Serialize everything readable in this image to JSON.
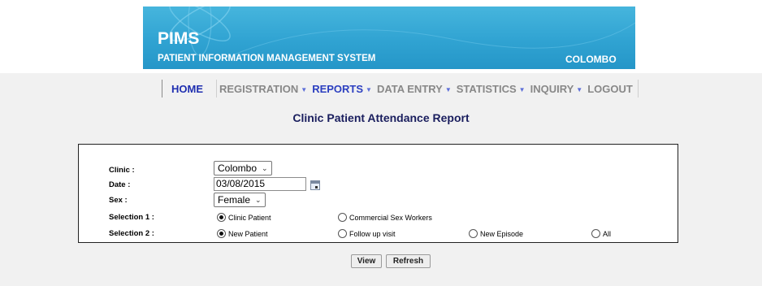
{
  "header": {
    "title": "PIMS",
    "subtitle": "PATIENT INFORMATION MANAGEMENT SYSTEM",
    "location": "COLOMBO"
  },
  "nav": {
    "items": [
      {
        "label": "HOME",
        "dropdown": false
      },
      {
        "label": "REGISTRATION",
        "dropdown": true
      },
      {
        "label": "REPORTS",
        "dropdown": true
      },
      {
        "label": "DATA ENTRY",
        "dropdown": true
      },
      {
        "label": "STATISTICS",
        "dropdown": true
      },
      {
        "label": "INQUIRY",
        "dropdown": true
      },
      {
        "label": "LOGOUT",
        "dropdown": false
      }
    ]
  },
  "report": {
    "title": "Clinic Patient Attendance Report"
  },
  "form": {
    "clinic": {
      "label": "Clinic :",
      "value": "Colombo"
    },
    "date": {
      "label": "Date :",
      "value": "03/08/2015"
    },
    "sex": {
      "label": "Sex :",
      "value": "Female"
    },
    "selection1": {
      "label": "Selection 1 :",
      "options": [
        {
          "label": "Clinic Patient",
          "checked": true
        },
        {
          "label": "Commercial Sex Workers",
          "checked": false
        }
      ]
    },
    "selection2": {
      "label": "Selection 2 :",
      "options": [
        {
          "label": "New Patient",
          "checked": true
        },
        {
          "label": "Follow up visit",
          "checked": false
        },
        {
          "label": "New Episode",
          "checked": false
        },
        {
          "label": "All",
          "checked": false
        }
      ]
    }
  },
  "buttons": {
    "view": "View",
    "refresh": "Refresh"
  },
  "colors": {
    "banner": "#30a3d2",
    "nav_active": "#1f2fb0",
    "nav_inactive": "#888888",
    "report_title": "#1a1e5e"
  }
}
